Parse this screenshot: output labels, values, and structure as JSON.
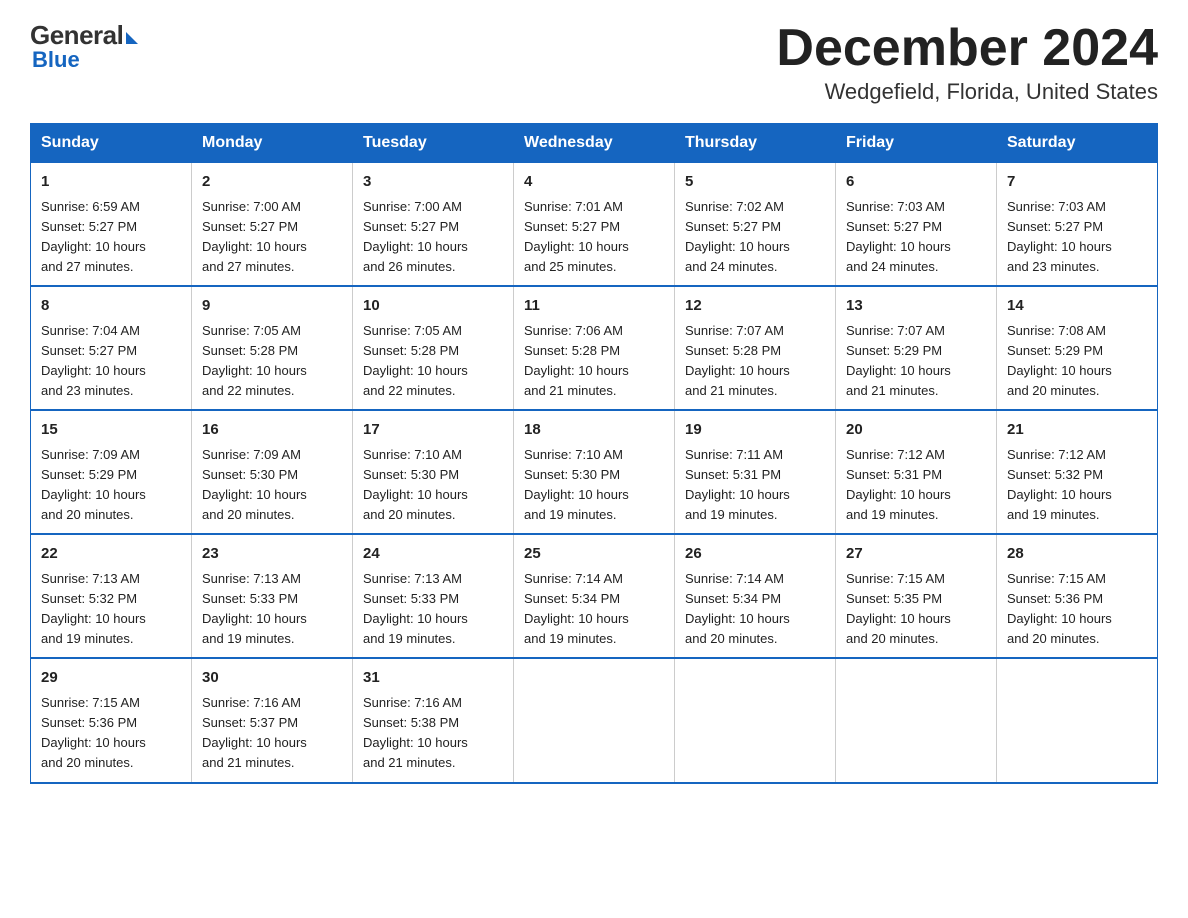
{
  "logo": {
    "general": "General",
    "blue": "Blue"
  },
  "header": {
    "month": "December 2024",
    "location": "Wedgefield, Florida, United States"
  },
  "weekdays": [
    "Sunday",
    "Monday",
    "Tuesday",
    "Wednesday",
    "Thursday",
    "Friday",
    "Saturday"
  ],
  "weeks": [
    [
      {
        "day": "1",
        "sunrise": "6:59 AM",
        "sunset": "5:27 PM",
        "daylight": "10 hours and 27 minutes."
      },
      {
        "day": "2",
        "sunrise": "7:00 AM",
        "sunset": "5:27 PM",
        "daylight": "10 hours and 27 minutes."
      },
      {
        "day": "3",
        "sunrise": "7:00 AM",
        "sunset": "5:27 PM",
        "daylight": "10 hours and 26 minutes."
      },
      {
        "day": "4",
        "sunrise": "7:01 AM",
        "sunset": "5:27 PM",
        "daylight": "10 hours and 25 minutes."
      },
      {
        "day": "5",
        "sunrise": "7:02 AM",
        "sunset": "5:27 PM",
        "daylight": "10 hours and 24 minutes."
      },
      {
        "day": "6",
        "sunrise": "7:03 AM",
        "sunset": "5:27 PM",
        "daylight": "10 hours and 24 minutes."
      },
      {
        "day": "7",
        "sunrise": "7:03 AM",
        "sunset": "5:27 PM",
        "daylight": "10 hours and 23 minutes."
      }
    ],
    [
      {
        "day": "8",
        "sunrise": "7:04 AM",
        "sunset": "5:27 PM",
        "daylight": "10 hours and 23 minutes."
      },
      {
        "day": "9",
        "sunrise": "7:05 AM",
        "sunset": "5:28 PM",
        "daylight": "10 hours and 22 minutes."
      },
      {
        "day": "10",
        "sunrise": "7:05 AM",
        "sunset": "5:28 PM",
        "daylight": "10 hours and 22 minutes."
      },
      {
        "day": "11",
        "sunrise": "7:06 AM",
        "sunset": "5:28 PM",
        "daylight": "10 hours and 21 minutes."
      },
      {
        "day": "12",
        "sunrise": "7:07 AM",
        "sunset": "5:28 PM",
        "daylight": "10 hours and 21 minutes."
      },
      {
        "day": "13",
        "sunrise": "7:07 AM",
        "sunset": "5:29 PM",
        "daylight": "10 hours and 21 minutes."
      },
      {
        "day": "14",
        "sunrise": "7:08 AM",
        "sunset": "5:29 PM",
        "daylight": "10 hours and 20 minutes."
      }
    ],
    [
      {
        "day": "15",
        "sunrise": "7:09 AM",
        "sunset": "5:29 PM",
        "daylight": "10 hours and 20 minutes."
      },
      {
        "day": "16",
        "sunrise": "7:09 AM",
        "sunset": "5:30 PM",
        "daylight": "10 hours and 20 minutes."
      },
      {
        "day": "17",
        "sunrise": "7:10 AM",
        "sunset": "5:30 PM",
        "daylight": "10 hours and 20 minutes."
      },
      {
        "day": "18",
        "sunrise": "7:10 AM",
        "sunset": "5:30 PM",
        "daylight": "10 hours and 19 minutes."
      },
      {
        "day": "19",
        "sunrise": "7:11 AM",
        "sunset": "5:31 PM",
        "daylight": "10 hours and 19 minutes."
      },
      {
        "day": "20",
        "sunrise": "7:12 AM",
        "sunset": "5:31 PM",
        "daylight": "10 hours and 19 minutes."
      },
      {
        "day": "21",
        "sunrise": "7:12 AM",
        "sunset": "5:32 PM",
        "daylight": "10 hours and 19 minutes."
      }
    ],
    [
      {
        "day": "22",
        "sunrise": "7:13 AM",
        "sunset": "5:32 PM",
        "daylight": "10 hours and 19 minutes."
      },
      {
        "day": "23",
        "sunrise": "7:13 AM",
        "sunset": "5:33 PM",
        "daylight": "10 hours and 19 minutes."
      },
      {
        "day": "24",
        "sunrise": "7:13 AM",
        "sunset": "5:33 PM",
        "daylight": "10 hours and 19 minutes."
      },
      {
        "day": "25",
        "sunrise": "7:14 AM",
        "sunset": "5:34 PM",
        "daylight": "10 hours and 19 minutes."
      },
      {
        "day": "26",
        "sunrise": "7:14 AM",
        "sunset": "5:34 PM",
        "daylight": "10 hours and 20 minutes."
      },
      {
        "day": "27",
        "sunrise": "7:15 AM",
        "sunset": "5:35 PM",
        "daylight": "10 hours and 20 minutes."
      },
      {
        "day": "28",
        "sunrise": "7:15 AM",
        "sunset": "5:36 PM",
        "daylight": "10 hours and 20 minutes."
      }
    ],
    [
      {
        "day": "29",
        "sunrise": "7:15 AM",
        "sunset": "5:36 PM",
        "daylight": "10 hours and 20 minutes."
      },
      {
        "day": "30",
        "sunrise": "7:16 AM",
        "sunset": "5:37 PM",
        "daylight": "10 hours and 21 minutes."
      },
      {
        "day": "31",
        "sunrise": "7:16 AM",
        "sunset": "5:38 PM",
        "daylight": "10 hours and 21 minutes."
      },
      null,
      null,
      null,
      null
    ]
  ],
  "labels": {
    "sunrise": "Sunrise:",
    "sunset": "Sunset:",
    "daylight": "Daylight:"
  }
}
